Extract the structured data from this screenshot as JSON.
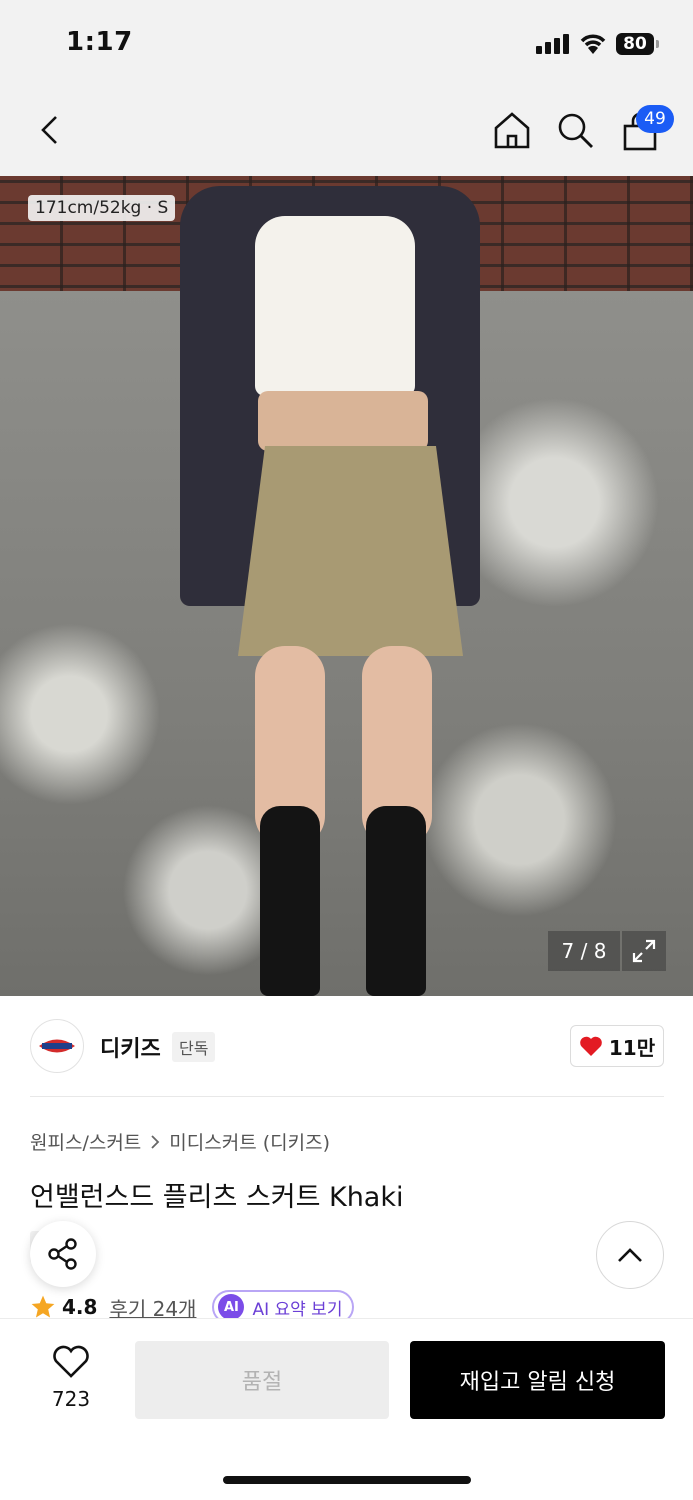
{
  "status_bar": {
    "time": "1:17",
    "battery": "80"
  },
  "header": {
    "cart_count": "49"
  },
  "gallery": {
    "size_tag": "171cm/52kg · S",
    "counter": "7 / 8"
  },
  "brand": {
    "name": "디키즈",
    "exclusive": "단독",
    "likes": "11만",
    "logo_text": "Dickies"
  },
  "product": {
    "breadcrumb": [
      "원피스/스커트",
      "미디스커트 (디키즈)"
    ],
    "title": "언밸런스드 플리츠 스커트 Khaki",
    "exclusive_tag": "단독",
    "rating": "4.8",
    "reviews": "후기 24개",
    "ai_summary": "AI 요약 보기",
    "ai_badge": "AI"
  },
  "bottom_bar": {
    "wish_count": "723",
    "soldout": "품절",
    "restock": "재입고 알림 신청"
  },
  "colors": {
    "accent": "#1b5cf5",
    "heart": "#e31b23",
    "ai": "#7b4ce8",
    "star": "#f5a623"
  }
}
